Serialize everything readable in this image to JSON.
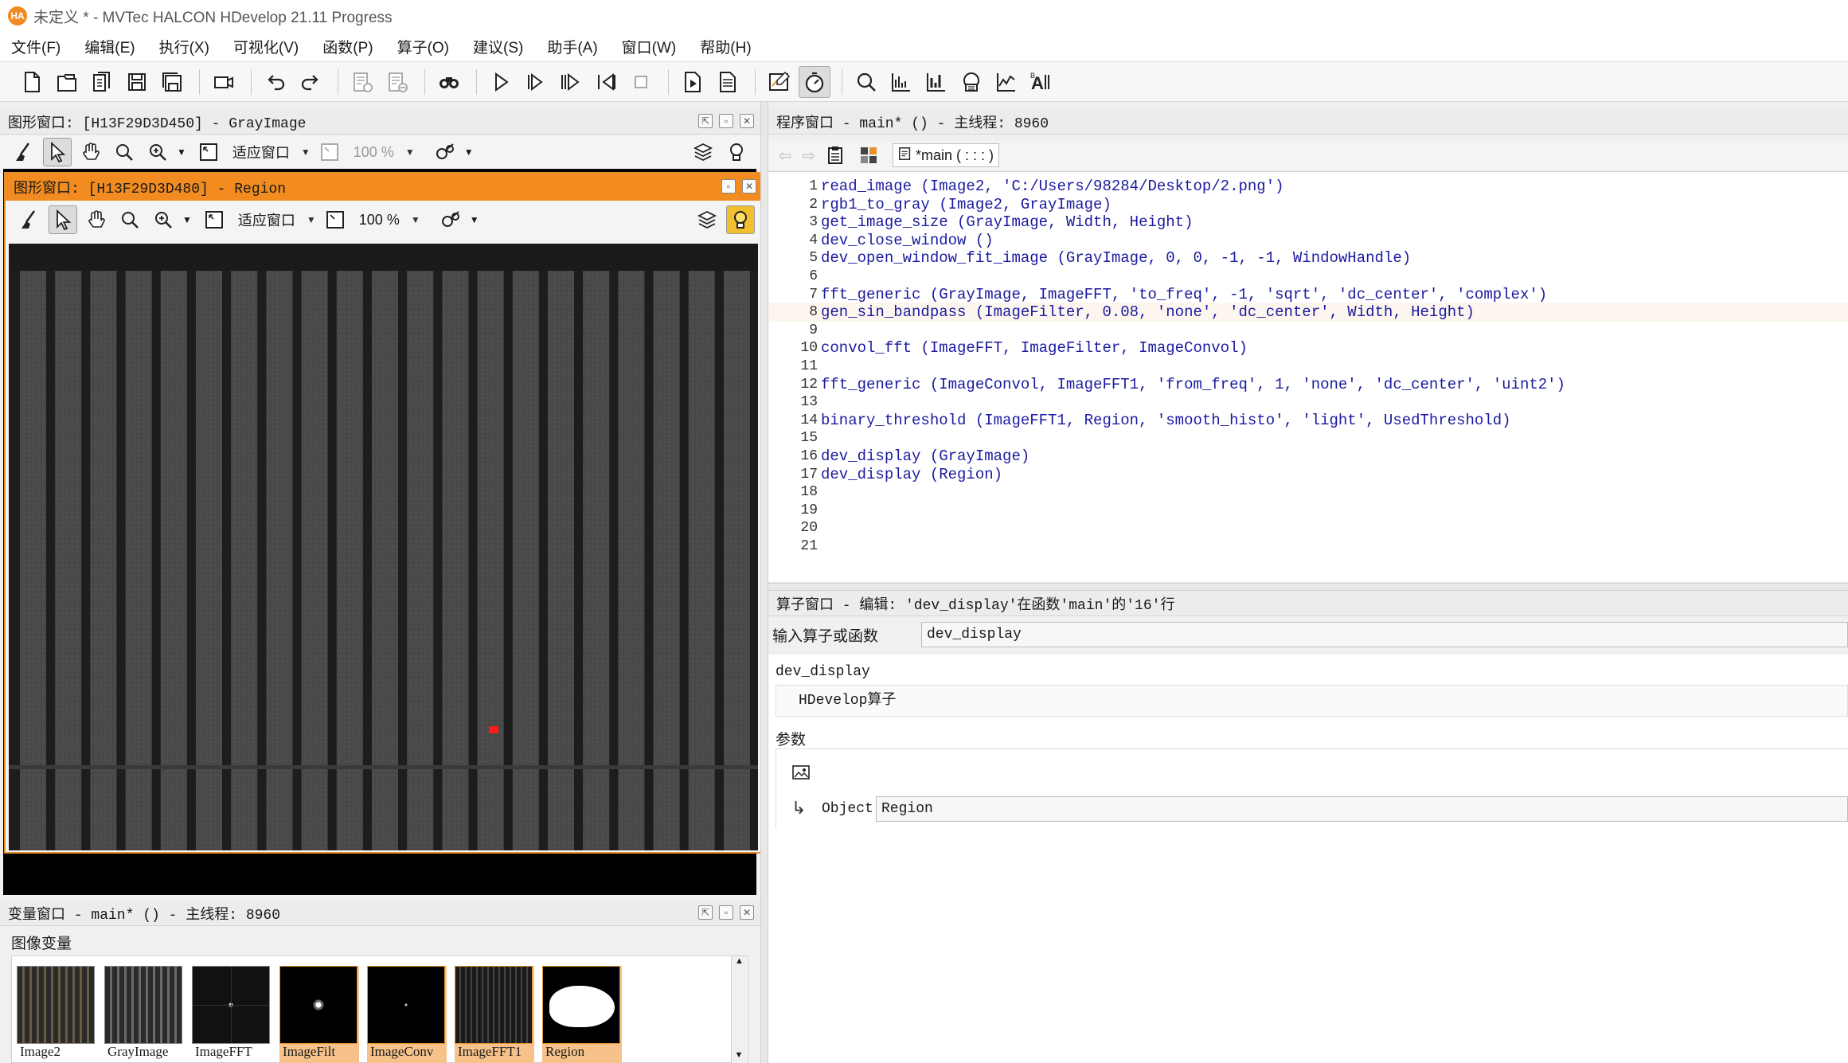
{
  "app": {
    "logo_text": "HA",
    "title": "未定义 * - MVTec HALCON HDevelop 21.11 Progress"
  },
  "menu": [
    "文件(F)",
    "编辑(E)",
    "执行(X)",
    "可视化(V)",
    "函数(P)",
    "算子(O)",
    "建议(S)",
    "助手(A)",
    "窗口(W)",
    "帮助(H)"
  ],
  "graphics_back": {
    "title": "图形窗口: [H13F29D3D450] - GrayImage",
    "fit_label": "适应窗口",
    "zoom_label": "100 %"
  },
  "graphics_front": {
    "title": "图形窗口: [H13F29D3D480] - Region",
    "fit_label": "适应窗口",
    "zoom_label": "100 %",
    "region_color": "#ff1a1a"
  },
  "variables": {
    "title": "变量窗口 - main* () - 主线程: 8960",
    "section": "图像变量",
    "items": [
      {
        "label": "Image2",
        "kind": "stripes",
        "highlight": false
      },
      {
        "label": "GrayImage",
        "kind": "stripes-gray",
        "highlight": false
      },
      {
        "label": "ImageFFT",
        "kind": "fft",
        "highlight": false
      },
      {
        "label": "ImageFilt",
        "kind": "dot",
        "highlight": true
      },
      {
        "label": "ImageConv",
        "kind": "small-dot",
        "highlight": true
      },
      {
        "label": "ImageFFT1",
        "kind": "stripes-dark",
        "highlight": true
      },
      {
        "label": "Region",
        "kind": "blob",
        "highlight": true
      }
    ]
  },
  "program": {
    "title": "程序窗口 - main* () - 主线程: 8960",
    "tab_label": "*main ( : : : )",
    "lines": [
      {
        "n": "1",
        "code": "read_image (Image2, 'C:/Users/98284/Desktop/2.png')"
      },
      {
        "n": "2",
        "code": "rgb1_to_gray (Image2, GrayImage)"
      },
      {
        "n": "3",
        "code": "get_image_size (GrayImage, Width, Height)"
      },
      {
        "n": "4",
        "code": "dev_close_window ()"
      },
      {
        "n": "5",
        "code": "dev_open_window_fit_image (GrayImage, 0, 0, -1, -1, WindowHandle)"
      },
      {
        "n": "6",
        "code": ""
      },
      {
        "n": "7",
        "code": "fft_generic (GrayImage, ImageFFT, 'to_freq', -1, 'sqrt', 'dc_center', 'complex')"
      },
      {
        "n": "8",
        "code": "gen_sin_bandpass (ImageFilter, 0.08, 'none', 'dc_center', Width, Height)"
      },
      {
        "n": "9",
        "code": ""
      },
      {
        "n": "10",
        "code": "convol_fft (ImageFFT, ImageFilter, ImageConvol)"
      },
      {
        "n": "11",
        "code": ""
      },
      {
        "n": "12",
        "code": "fft_generic (ImageConvol, ImageFFT1, 'from_freq', 1, 'none', 'dc_center', 'uint2')"
      },
      {
        "n": "13",
        "code": ""
      },
      {
        "n": "14",
        "code": "binary_threshold (ImageFFT1, Region, 'smooth_histo', 'light', UsedThreshold)"
      },
      {
        "n": "15",
        "code": ""
      },
      {
        "n": "16",
        "code": "dev_display (GrayImage)"
      },
      {
        "n": "17",
        "code": "dev_display (Region)"
      },
      {
        "n": "18",
        "code": ""
      },
      {
        "n": "19",
        "code": ""
      },
      {
        "n": "20",
        "code": ""
      },
      {
        "n": "21",
        "code": ""
      }
    ],
    "current_line": 8
  },
  "operator": {
    "title": "算子窗口 - 编辑: 'dev_display'在函数'main'的'16'行",
    "input_label": "输入算子或函数",
    "input_value": "dev_display",
    "name": "dev_display",
    "category": "HDevelop算子",
    "params_label": "参数",
    "param_name": "Object",
    "param_value": "Region"
  },
  "colors": {
    "accent": "#f28c20",
    "code_text": "#1a1aa0",
    "highlight_thumb": "#f6c28a"
  }
}
